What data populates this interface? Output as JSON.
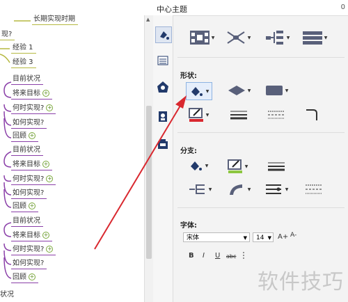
{
  "mindmap": {
    "top_branch": "长期实现时期",
    "partial_top": "现?",
    "exp1": "经验 1",
    "exp2": "经验 3",
    "groups": [
      {
        "a": "目前状况",
        "b": "将来目标",
        "c": "何时实现?",
        "d": "如何实现?",
        "e": "回顾"
      },
      {
        "a": "目前状况",
        "b": "将来目标",
        "c": "何时实现?",
        "d": "如何实现?",
        "e": "回顾"
      },
      {
        "a": "目前状况",
        "b": "将来目标",
        "c": "何时实现?",
        "d": "如何实现?",
        "e": "回顾"
      }
    ],
    "partial_bottom": "状况"
  },
  "panel": {
    "title": "中心主题",
    "corner": "0",
    "shape_label": "形状:",
    "branch_label": "分支:",
    "font_label": "字体:",
    "font_name": "宋体",
    "font_size": "14",
    "grow": "A+",
    "shrink": "A-",
    "bold": "B",
    "italic": "I",
    "underline": "U",
    "strike": "abc"
  },
  "watermark": "软件技巧",
  "colors": {
    "accent_red": "#d9282f",
    "branch_olive": "#b5b840",
    "branch_purple": "#8a3fa8",
    "fill_green": "#8cc63f"
  },
  "icons": [
    "paint-bucket-icon",
    "list-icon",
    "theme-icon",
    "clipart-icon",
    "attachment-icon"
  ]
}
